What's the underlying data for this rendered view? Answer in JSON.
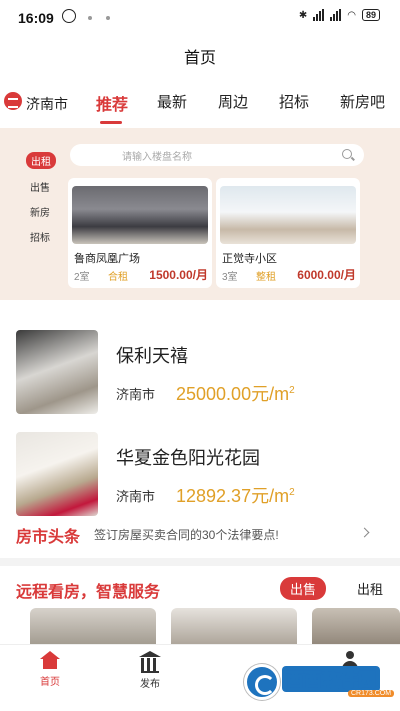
{
  "status_bar": {
    "time": "16:09",
    "battery": "89"
  },
  "page_title": "首页",
  "city": "济南市",
  "tabs": [
    {
      "label": "推荐"
    },
    {
      "label": "最新"
    },
    {
      "label": "周边"
    },
    {
      "label": "招标"
    },
    {
      "label": "新房吧"
    }
  ],
  "search": {
    "placeholder": "请输入楼盘名称"
  },
  "side_menu": [
    {
      "label": "出租"
    },
    {
      "label": "出售"
    },
    {
      "label": "新房"
    },
    {
      "label": "招标"
    }
  ],
  "cards": [
    {
      "name": "鲁商凤凰广场",
      "rooms": "2室",
      "type": "合租",
      "price": "1500.00/月"
    },
    {
      "name": "正觉寺小区",
      "rooms": "3室",
      "type": "整租",
      "price": "6000.00/月"
    }
  ],
  "listings": [
    {
      "name": "保利天禧",
      "city": "济南市",
      "price": "25000.00元/m",
      "sup": "2"
    },
    {
      "name": "华夏金色阳光花园",
      "city": "济南市",
      "price": "12892.37元/m",
      "sup": "2"
    }
  ],
  "news": {
    "label": "房市头条",
    "text": "签订房屋买卖合同的30个法律要点!"
  },
  "remote": {
    "title": "远程看房，智慧服务",
    "tab_on": "出售",
    "tab_off": "出租"
  },
  "bottom_nav": [
    {
      "label": "首页"
    },
    {
      "label": "发布"
    }
  ],
  "watermark": {
    "text": "西西软件园",
    "url": "CR173.COM"
  },
  "colors": {
    "accent": "#d93a3a",
    "price": "#e0a028",
    "panel_bg": "#f7ece4"
  }
}
